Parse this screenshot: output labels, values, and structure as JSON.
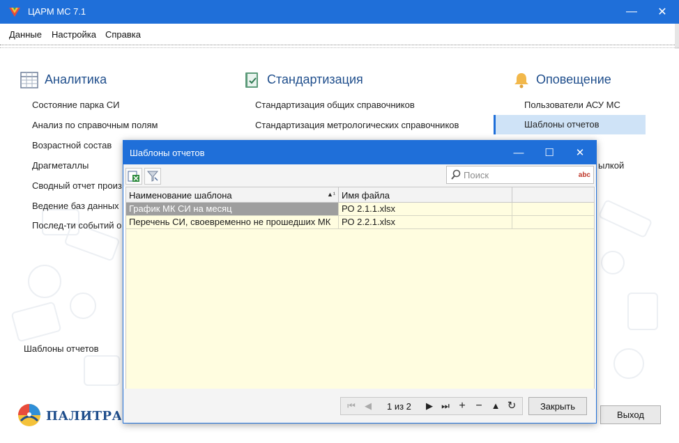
{
  "window": {
    "title": "ЦАРМ МС 7.1",
    "minimize": "—",
    "close": "✕",
    "accent_color": "#1f6fd9"
  },
  "menu": [
    "Данные",
    "Настройка",
    "Справка"
  ],
  "sections": {
    "analytics": {
      "title": "Аналитика",
      "icon": "table-icon",
      "items": [
        "Состояние парка СИ",
        "Анализ по справочным полям",
        "Возрастной состав",
        "Драгметаллы",
        "Сводный отчет произ",
        "Ведение баз данных",
        "Послед-ти событий о"
      ]
    },
    "standardization": {
      "title": "Стандартизация",
      "icon": "book-check-icon",
      "items": [
        "Стандартизация общих справочников",
        "Стандартизация метрологических справочников"
      ]
    },
    "notification": {
      "title": "Оповещение",
      "icon": "bell-icon",
      "items": [
        "Пользователи АСУ МС",
        "Шаблоны отчетов",
        "ылкой"
      ],
      "selected_index": 1
    }
  },
  "status_label": "Шаблоны отчетов",
  "exit_button": "Выход",
  "logo": {
    "text": "ПАЛИТРА СИ"
  },
  "dialog": {
    "title": "Шаблоны отчетов",
    "controls": {
      "minimize": "—",
      "maximize": "☐",
      "close": "✕"
    },
    "toolbar": {
      "search_placeholder": "Поиск",
      "spellcheck_label": "abc"
    },
    "grid": {
      "columns": [
        "Наименование шаблона",
        "Имя файла"
      ],
      "sort_indicator": "▲¹",
      "rows": [
        {
          "name": "График МК СИ на месяц",
          "file": "РО 2.1.1.xlsx",
          "selected": true
        },
        {
          "name": "Перечень СИ, своевременно не прошедших МК",
          "file": "РО 2.2.1.xlsx",
          "selected": false
        }
      ]
    },
    "pager": {
      "first": "⏮",
      "prev": "◀",
      "page_text": "1 из 2",
      "next": "▶",
      "last": "⏭",
      "add": "+",
      "remove": "−",
      "up": "▲",
      "refresh": "↻"
    },
    "close_button": "Закрыть"
  }
}
